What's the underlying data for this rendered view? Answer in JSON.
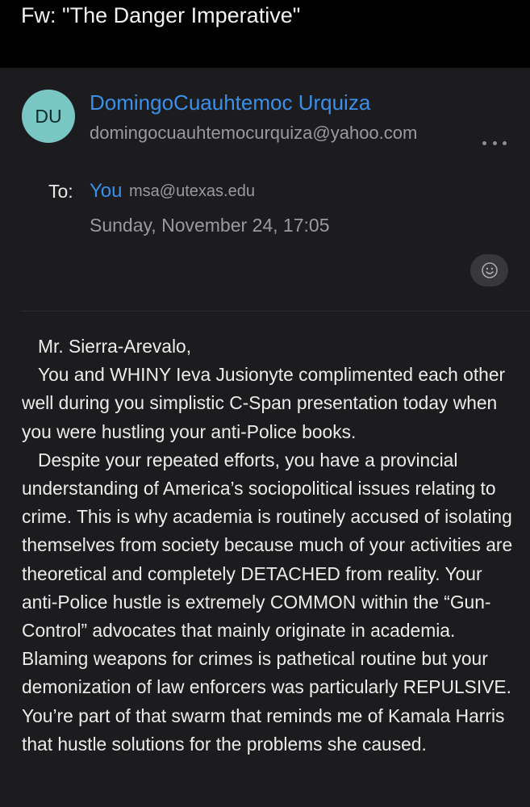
{
  "email": {
    "subject": "Fw: \"The Danger Imperative\"",
    "sender": {
      "initials": "DU",
      "name": "DomingoCuauhtemoc Urquiza",
      "email": "domingocuauhtemocurquiza@yahoo.com"
    },
    "to_label": "To:",
    "recipient_name": "You",
    "recipient_email": "msa@utexas.edu",
    "date": "Sunday, November 24, 17:05",
    "icons": {
      "more": "more-horizontal-icon",
      "react": "smiley-face-icon"
    },
    "colors": {
      "background": "#000000",
      "card": "#1c1c1e",
      "link_blue": "#3a8fe8",
      "avatar": "#79c7c5",
      "secondary_text": "#9a9a9e"
    },
    "body": {
      "greeting": "Mr. Sierra-Arevalo,",
      "paragraph_1": "You and WHINY Ieva Jusionyte complimented each other well during you simplistic C-Span presentation today when you were hustling your anti-Police books.",
      "paragraph_2": "Despite your repeated efforts, you have a provincial understanding of America’s sociopolitical issues relating to crime.  This is why academia is routinely accused of isolating themselves from society because much of your activities are theoretical and completely DETACHED from reality.  Your anti-Police hustle is extremely COMMON within the “Gun-Control” advocates that mainly originate in academia. Blaming weapons for crimes is pathetical routine but your demonization of law enforcers was particularly REPULSIVE.  You’re part of that swarm that reminds me of Kamala Harris that hustle solutions for the problems she caused."
    }
  }
}
